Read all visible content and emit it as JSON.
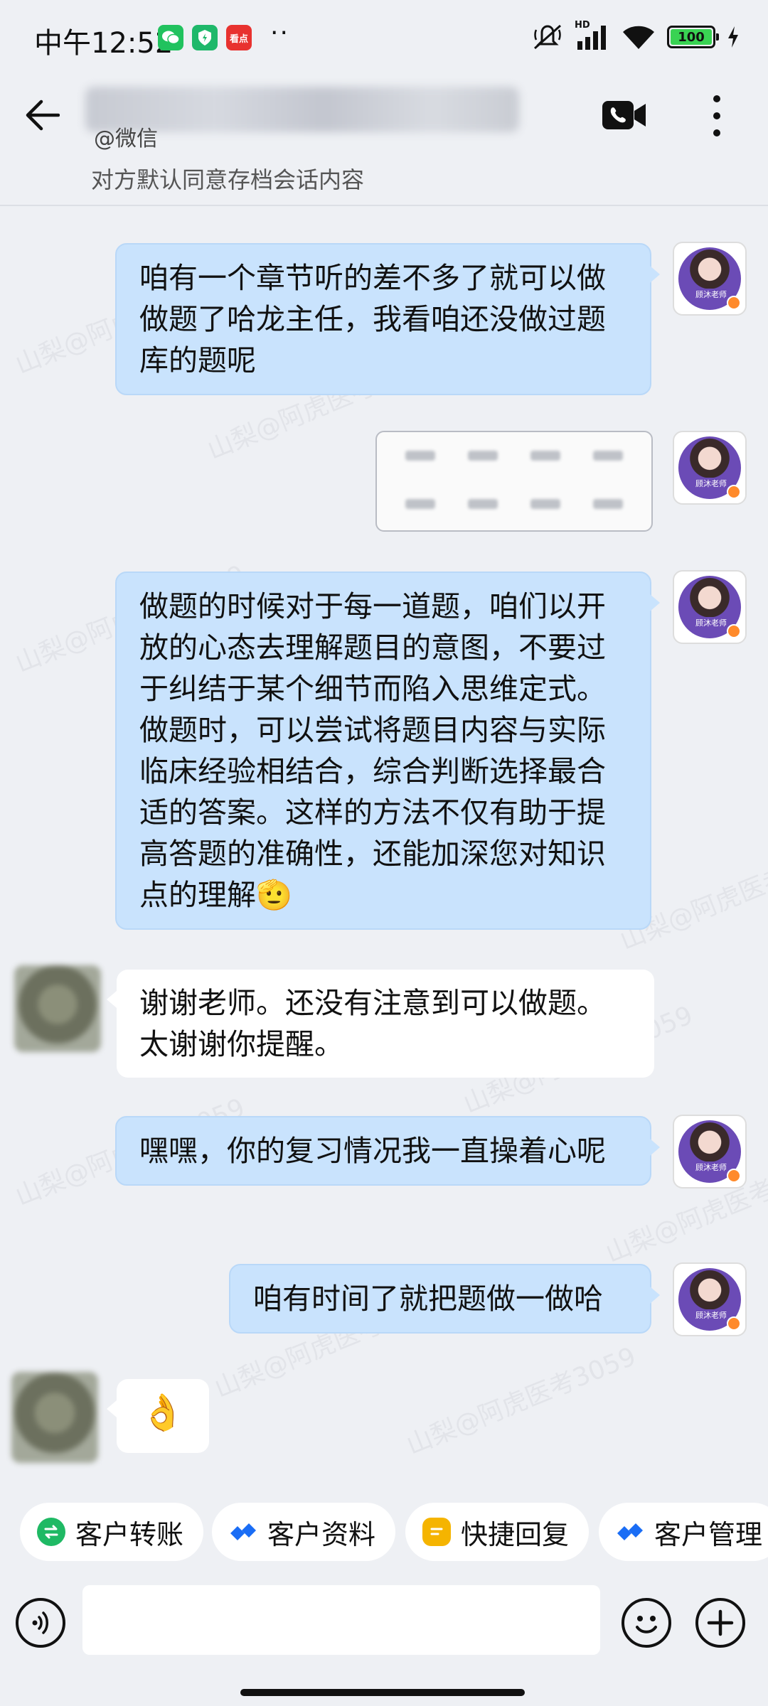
{
  "status_bar": {
    "time": "中午12:52",
    "app_icons": [
      "wechat-icon",
      "shield-icon",
      "kandian-icon"
    ],
    "kandian_label": "看点",
    "more_dots": "··",
    "hd_label": "HD",
    "battery": "100"
  },
  "header": {
    "contact_source": "@微信",
    "subtitle": "对方默认同意存档会话内容"
  },
  "watermark_text": "山梨@阿虎医考3059",
  "messages": [
    {
      "side": "out",
      "type": "text",
      "text": "咱有一个章节听的差不多了就可以做做题了哈龙主任，我看咱还没做过题库的题呢"
    },
    {
      "side": "out",
      "type": "image"
    },
    {
      "side": "out",
      "type": "text",
      "text": "做题的时候对于每一道题，咱们以开放的心态去理解题目的意图，不要过于纠结于某个细节而陷入思维定式。做题时，可以尝试将题目内容与实际临床经验相结合，综合判断选择最合适的答案。这样的方法不仅有助于提高答题的准确性，还能加深您对知识点的理解",
      "emoji": "🫡"
    },
    {
      "side": "in",
      "type": "text",
      "text": "谢谢老师。还没有注意到可以做题。太谢谢你提醒。"
    },
    {
      "side": "out",
      "type": "text",
      "text": "嘿嘿，你的复习情况我一直操着心呢"
    },
    {
      "side": "out",
      "type": "text",
      "text": "咱有时间了就把题做一做哈"
    },
    {
      "side": "in",
      "type": "emoji",
      "text": "👌"
    }
  ],
  "self_avatar_label": "顾沐老师",
  "quick_actions": [
    {
      "label": "客户转账",
      "icon": "transfer-icon",
      "color": "#1fb964"
    },
    {
      "label": "客户资料",
      "icon": "profile-icon",
      "color": "#1a6df5"
    },
    {
      "label": "快捷回复",
      "icon": "quick-reply-icon",
      "color": "#f5b400"
    },
    {
      "label": "客户管理",
      "icon": "manage-icon",
      "color": "#1a6df5"
    }
  ],
  "input": {
    "placeholder": ""
  },
  "colors": {
    "background": "#eef0f4",
    "outgoing_bubble": "#c9e3fd",
    "incoming_bubble": "#ffffff"
  }
}
